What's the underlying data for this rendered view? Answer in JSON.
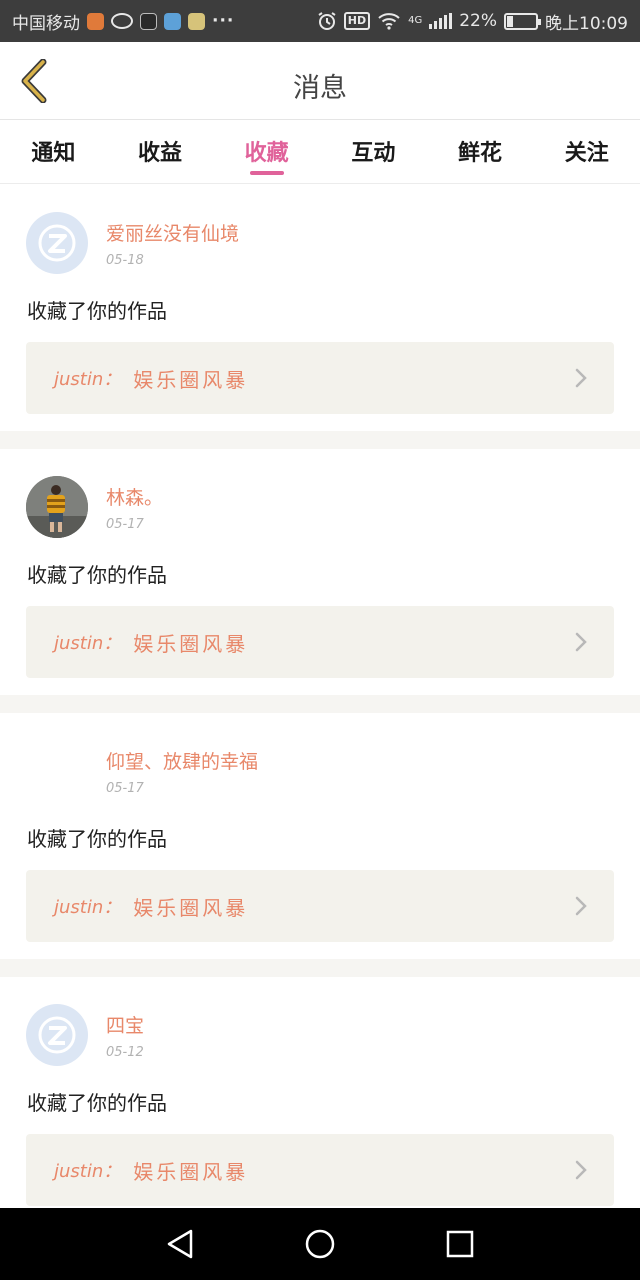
{
  "status_bar": {
    "carrier": "中国移动",
    "more": "···",
    "hd": "HD",
    "network": "4G",
    "battery_text": "22%",
    "battery_level": 0.22,
    "time": "晚上10:09"
  },
  "header": {
    "title": "消息"
  },
  "tabs": [
    {
      "label": "通知"
    },
    {
      "label": "收益"
    },
    {
      "label": "收藏"
    },
    {
      "label": "互动"
    },
    {
      "label": "鲜花"
    },
    {
      "label": "关注"
    }
  ],
  "active_tab": "收藏",
  "feed": [
    {
      "username": "爱丽丝没有仙境",
      "date": "05-18",
      "action": "收藏了你的作品",
      "work_author": "justin：",
      "work_title": "娱乐圈风暴",
      "avatar": "default-q-avatar"
    },
    {
      "username": "林森。",
      "date": "05-17",
      "action": "收藏了你的作品",
      "work_author": "justin：",
      "work_title": "娱乐圈风暴",
      "avatar": "photo-avatar"
    },
    {
      "username": "仰望、放肆的幸福",
      "date": "05-17",
      "action": "收藏了你的作品",
      "work_author": "justin：",
      "work_title": "娱乐圈风暴",
      "avatar": "none"
    },
    {
      "username": "四宝",
      "date": "05-12",
      "action": "收藏了你的作品",
      "work_author": "justin：",
      "work_title": "娱乐圈风暴",
      "avatar": "default-q-avatar"
    }
  ],
  "colors": {
    "accent_pink": "#e0629a",
    "name_orange": "#e8886a",
    "back_arrow": "#d8b24a"
  }
}
